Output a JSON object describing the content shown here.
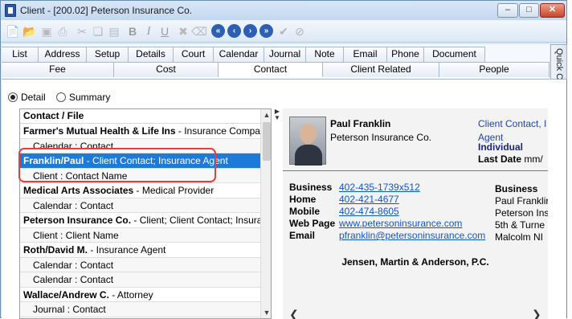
{
  "window": {
    "title": "Client - [200.02] Peterson Insurance Co."
  },
  "toolbar": {
    "icons": [
      "new-document-icon",
      "open-folder-icon",
      "save-icon",
      "print-icon",
      "cut-icon",
      "copy-icon",
      "paste-icon",
      "bold-icon",
      "italic-icon",
      "underline-icon",
      "delete-icon",
      "clear-icon",
      "first-record-icon",
      "previous-record-icon",
      "next-record-icon",
      "last-record-icon",
      "checkmark-icon",
      "cancel-icon"
    ]
  },
  "tabs": {
    "row1": [
      "List",
      "Address",
      "Setup",
      "Details",
      "Court",
      "Calendar",
      "Journal",
      "Note",
      "Email",
      "Phone",
      "Document"
    ],
    "row2": [
      "Fee",
      "Cost",
      "Contact",
      "Client Related",
      "People"
    ],
    "active": "Contact"
  },
  "quick_clicks": "Quick Clicks",
  "view_options": {
    "detail": "Detail",
    "summary": "Summary",
    "selected": "Detail"
  },
  "list": {
    "header": "Contact / File",
    "rows": [
      {
        "name": "Farmer's Mutual Health & Life Ins",
        "desc": " - Insurance Companies",
        "level": 0
      },
      {
        "name": "",
        "desc": "Calendar : Contact",
        "level": 1
      },
      {
        "name": "Franklin/Paul",
        "desc": " - Client Contact; Insurance Agent",
        "level": 0,
        "selected": true
      },
      {
        "name": "",
        "desc": "Client : Contact Name",
        "level": 1
      },
      {
        "name": "Medical Arts Associates",
        "desc": " - Medical Provider",
        "level": 0
      },
      {
        "name": "",
        "desc": "Calendar : Contact",
        "level": 1
      },
      {
        "name": "Peterson Insurance Co.",
        "desc": " - Client; Client Contact; Insurance C",
        "level": 0
      },
      {
        "name": "",
        "desc": "Client : Client Name",
        "level": 1
      },
      {
        "name": "Roth/David M.",
        "desc": " - Insurance Agent",
        "level": 0
      },
      {
        "name": "",
        "desc": "Calendar : Contact",
        "level": 1
      },
      {
        "name": "",
        "desc": "Calendar : Contact",
        "level": 1
      },
      {
        "name": "Wallace/Andrew C.",
        "desc": " - Attorney",
        "level": 0
      },
      {
        "name": "",
        "desc": "Journal : Contact",
        "level": 1
      }
    ]
  },
  "detail": {
    "name": "Paul Franklin",
    "company": "Peterson Insurance Co.",
    "type": "Client Contact, I",
    "agent": "Agent",
    "individual": "Individual",
    "last_date_label": "Last Date",
    "last_date_value": "mm/",
    "contacts": [
      {
        "label": "Business",
        "value": "402-435-1739x512"
      },
      {
        "label": "Home",
        "value": "402-421-4677"
      },
      {
        "label": "Mobile",
        "value": "402-474-8605"
      },
      {
        "label": "Web Page",
        "value": "www.petersoninsurance.com"
      },
      {
        "label": "Email",
        "value": "pfranklin@petersoninsurance.com"
      }
    ],
    "business_address": [
      "Business",
      "Paul Franklir",
      "Peterson Ins",
      "5th & Turne",
      "Malcolm  NI"
    ],
    "firm": "Jensen, Martin & Anderson, P.C."
  },
  "colors": {
    "selection": "#1e7ad8",
    "highlight_box": "#e0403e",
    "link": "#1155cc"
  }
}
